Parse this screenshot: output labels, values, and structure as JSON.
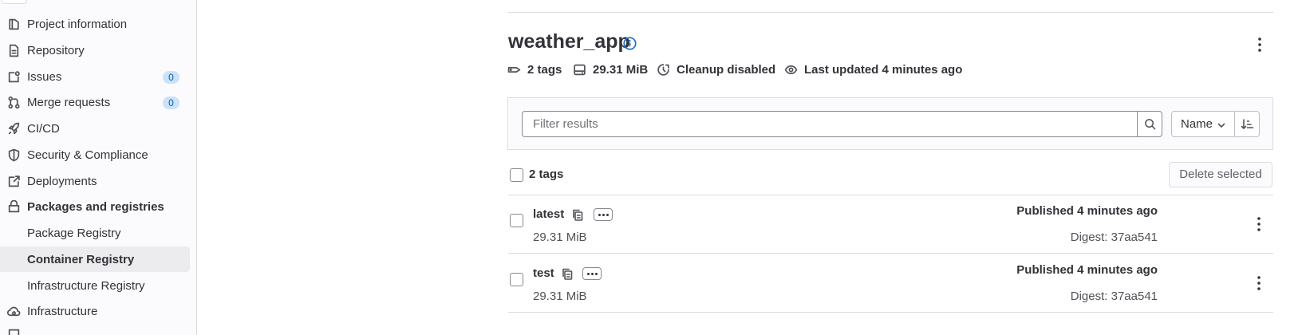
{
  "sidebar": {
    "items": [
      {
        "label": "Project information",
        "icon": "project-icon"
      },
      {
        "label": "Repository",
        "icon": "document-icon"
      },
      {
        "label": "Issues",
        "icon": "issues-icon",
        "badge": "0"
      },
      {
        "label": "Merge requests",
        "icon": "merge-request-icon",
        "badge": "0"
      },
      {
        "label": "CI/CD",
        "icon": "rocket-icon"
      },
      {
        "label": "Security & Compliance",
        "icon": "shield-icon"
      },
      {
        "label": "Deployments",
        "icon": "deployments-icon"
      },
      {
        "label": "Packages and registries",
        "icon": "package-icon"
      },
      {
        "label": "Infrastructure",
        "icon": "cloud-gear-icon"
      }
    ],
    "subitems": [
      {
        "label": "Package Registry"
      },
      {
        "label": "Container Registry",
        "active": true
      },
      {
        "label": "Infrastructure Registry"
      }
    ]
  },
  "header": {
    "title": "weather_app",
    "meta": {
      "tags": "2 tags",
      "size": "29.31 MiB",
      "cleanup": "Cleanup disabled",
      "updated": "Last updated 4 minutes ago"
    }
  },
  "filter": {
    "placeholder": "Filter results",
    "sort_label": "Name"
  },
  "list": {
    "count_label": "2 tags",
    "delete_label": "Delete selected",
    "rows": [
      {
        "name": "latest",
        "size": "29.31 MiB",
        "published": "Published 4 minutes ago",
        "digest": "Digest: 37aa541"
      },
      {
        "name": "test",
        "size": "29.31 MiB",
        "published": "Published 4 minutes ago",
        "digest": "Digest: 37aa541"
      }
    ]
  },
  "colors": {
    "badge_bg": "#cbe2f9",
    "badge_text": "#0b5cad",
    "info_blue": "#1f75cb",
    "active_bg": "#ececef"
  }
}
